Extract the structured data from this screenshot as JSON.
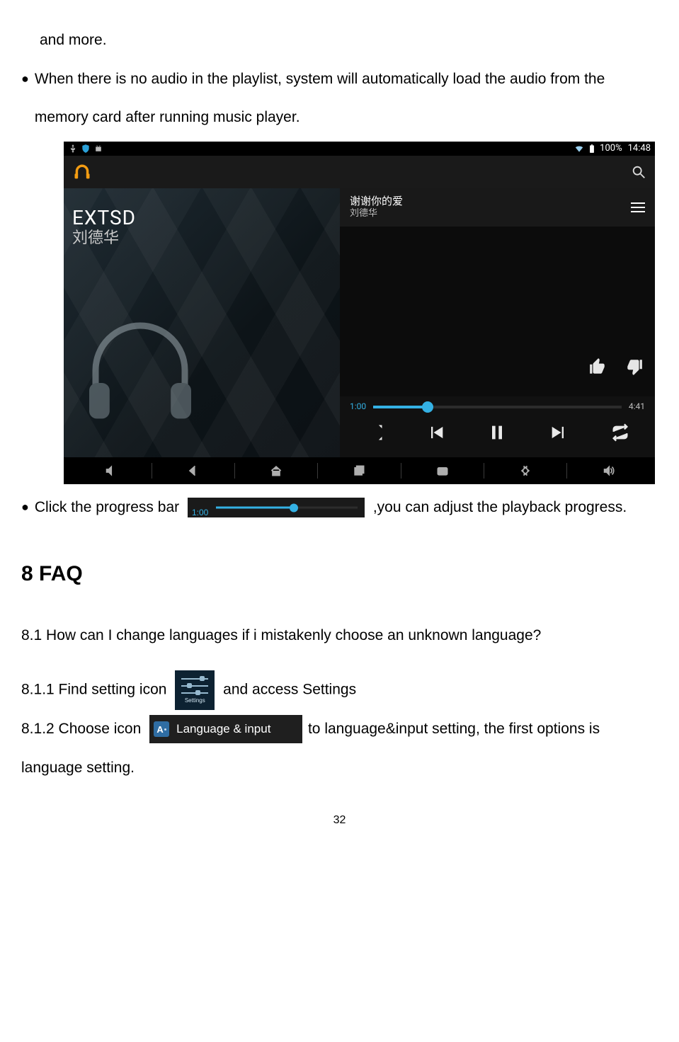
{
  "body": {
    "frag_top": "and more.",
    "bullet_autoload": "When there is no audio in the playlist, system will automatically load the audio from the memory card after running music player.",
    "bullet_progress_1": "Click the progress bar ",
    "bullet_progress_2": " ,you can adjust the playback progress.",
    "faq_heading": "8 FAQ",
    "q81": "8.1 How can I change languages if i mistakenly choose an unknown language?",
    "s811_a": "8.1.1 Find setting icon ",
    "s811_b": " and access Settings",
    "s812_a": "8.1.2 Choose icon ",
    "s812_b": "to language&input setting, the first options is language setting.",
    "pagenum": "32"
  },
  "screenshot": {
    "status": {
      "battery": "100%",
      "time": "14:48"
    },
    "album": {
      "title": "EXTSD",
      "artist": "刘德华"
    },
    "now_playing": {
      "track": "谢谢你的爱",
      "artist": "刘德华"
    },
    "seek": {
      "elapsed": "1:00",
      "duration": "4:41",
      "progress_pct": 22
    }
  },
  "inline_progress": {
    "elapsed": "1:00",
    "progress_pct": 55
  },
  "settings_icon_label": "Settings",
  "lang_input": {
    "letter": "A",
    "label": "Language & input"
  }
}
